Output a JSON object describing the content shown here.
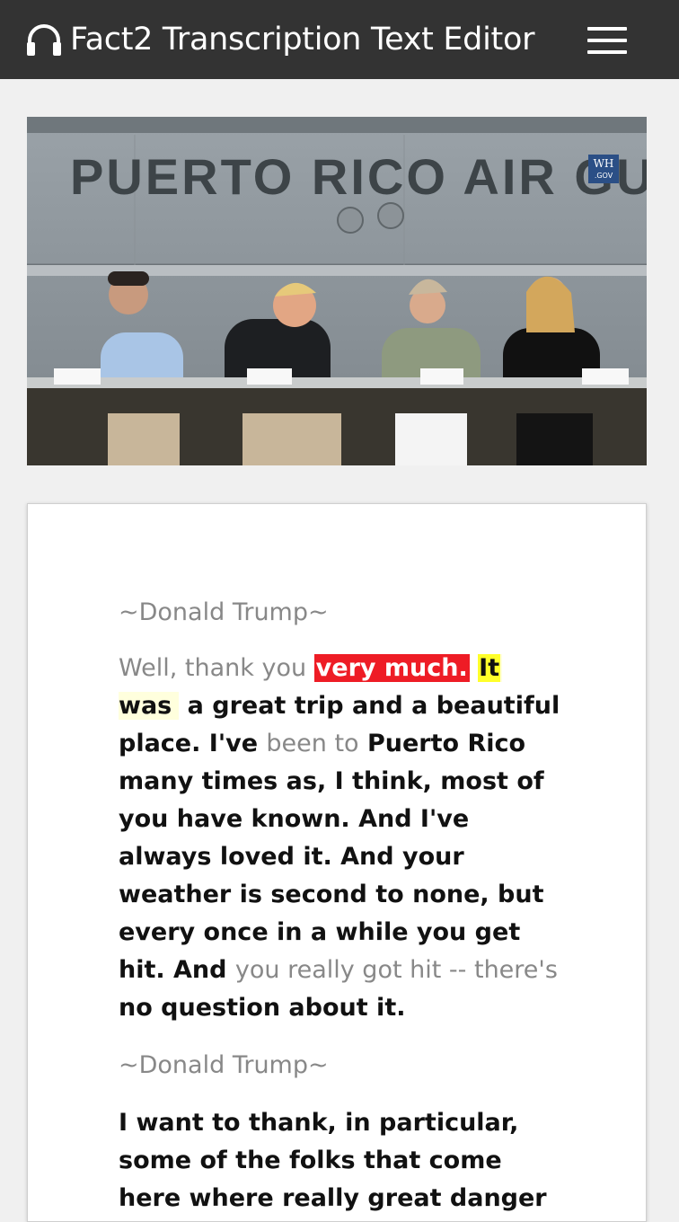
{
  "header": {
    "title": "Fact2 Transcription Text Editor",
    "icon": "headphones-icon",
    "menu_icon": "hamburger-menu-icon",
    "background": "#333333"
  },
  "video": {
    "sign_text": "PUERTO RICO AIR GUAR",
    "watermark_top": "WH",
    "watermark_bottom": ".GOV"
  },
  "transcript": {
    "blocks": [
      {
        "speaker": "~Donald Trump~",
        "segments": [
          {
            "text": "Well, thank you ",
            "style": "unread"
          },
          {
            "text": "very much.",
            "style": "current"
          },
          {
            "text": " ",
            "style": "plain"
          },
          {
            "text": "It",
            "style": "next"
          },
          {
            "text": " was",
            "style": "upcoming"
          },
          {
            "text": " a great trip and a beautiful place. I've ",
            "style": "plain"
          },
          {
            "text": "been to",
            "style": "unread"
          },
          {
            "text": " Puerto Rico many times as, I think, most of you have known. And I've always loved it. And your weather is second to none, but every once in a while you get hit. And ",
            "style": "plain"
          },
          {
            "text": "you really got hit -- there's",
            "style": "unread"
          },
          {
            "text": " no question about it.",
            "style": "plain"
          }
        ]
      },
      {
        "speaker": "~Donald Trump~",
        "segments": [
          {
            "text": "I want to thank, in particular, some of the folks that come here where really great danger",
            "style": "plain"
          }
        ]
      }
    ]
  },
  "colors": {
    "highlight_current": "#ee1c25",
    "highlight_next": "#ffff2a",
    "highlight_upcoming": "#ffffdd",
    "unread_text": "#888888"
  }
}
